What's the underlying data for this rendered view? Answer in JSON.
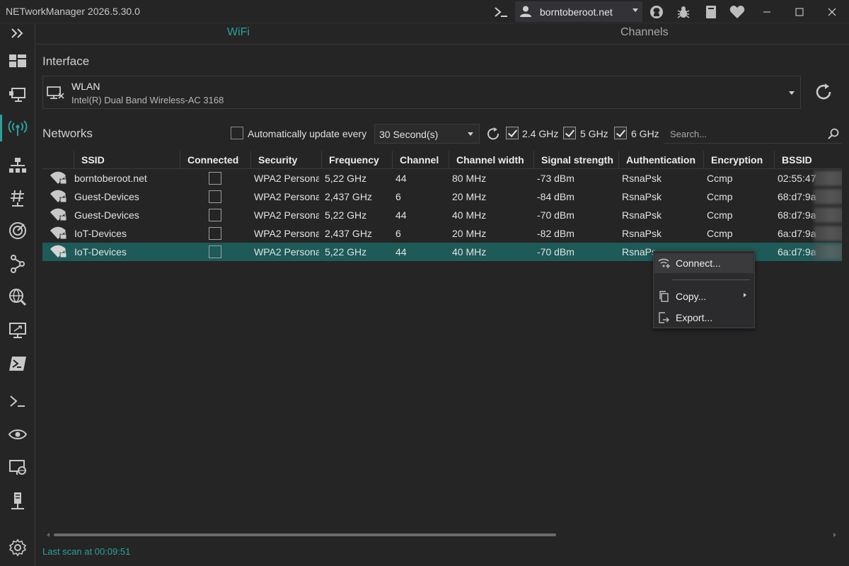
{
  "app": {
    "title": "NETworkManager 2026.5.30.0"
  },
  "titlebar": {
    "profile_name": "borntoberoot.net"
  },
  "tabs": [
    {
      "label": "WiFi",
      "active": true
    },
    {
      "label": "Channels",
      "active": false
    }
  ],
  "interface": {
    "section_label": "Interface",
    "name": "WLAN",
    "description": "Intel(R) Dual Band Wireless-AC 3168"
  },
  "networks": {
    "section_label": "Networks",
    "auto_update_label": "Automatically update every",
    "auto_update_checked": false,
    "interval_value": "30 Second(s)",
    "band_24": {
      "label": "2.4 GHz",
      "checked": true
    },
    "band_5": {
      "label": "5 GHz",
      "checked": true
    },
    "band_6": {
      "label": "6 GHz",
      "checked": true
    },
    "search_placeholder": "Search..."
  },
  "table": {
    "columns": [
      "SSID",
      "Connected",
      "Security",
      "Frequency",
      "Channel",
      "Channel width",
      "Signal strength",
      "Authentication",
      "Encryption",
      "BSSID"
    ],
    "rows": [
      {
        "ssid": "borntoberoot.net",
        "security": "WPA2 Persona",
        "frequency": "5,22 GHz",
        "channel": "44",
        "width": "80 MHz",
        "signal": "-73 dBm",
        "auth": "RsnaPsk",
        "enc": "Ccmp",
        "bssid": "02:55:47"
      },
      {
        "ssid": "Guest-Devices",
        "security": "WPA2 Persona",
        "frequency": "2,437 GHz",
        "channel": "6",
        "width": "20 MHz",
        "signal": "-84 dBm",
        "auth": "RsnaPsk",
        "enc": "Ccmp",
        "bssid": "68:d7:9a"
      },
      {
        "ssid": "Guest-Devices",
        "security": "WPA2 Persona",
        "frequency": "5,22 GHz",
        "channel": "44",
        "width": "40 MHz",
        "signal": "-70 dBm",
        "auth": "RsnaPsk",
        "enc": "Ccmp",
        "bssid": "68:d7:9a"
      },
      {
        "ssid": "IoT-Devices",
        "security": "WPA2 Persona",
        "frequency": "2,437 GHz",
        "channel": "6",
        "width": "20 MHz",
        "signal": "-82 dBm",
        "auth": "RsnaPsk",
        "enc": "Ccmp",
        "bssid": "6a:d7:9a"
      },
      {
        "ssid": "IoT-Devices",
        "security": "WPA2 Persona",
        "frequency": "5,22 GHz",
        "channel": "44",
        "width": "40 MHz",
        "signal": "-70 dBm",
        "auth": "RsnaPs",
        "enc": "",
        "bssid": "6a:d7:9a"
      }
    ]
  },
  "context_menu": {
    "items": [
      {
        "label": "Connect...",
        "icon": "wifi-connect-icon"
      },
      {
        "label": "Copy...",
        "icon": "copy-icon",
        "submenu": true
      },
      {
        "label": "Export...",
        "icon": "export-icon"
      }
    ]
  },
  "status": {
    "last_scan": "Last scan at 00:09:51"
  },
  "colors": {
    "accent": "#2aa198",
    "selected_row": "#1d5a58",
    "background": "#252526"
  }
}
